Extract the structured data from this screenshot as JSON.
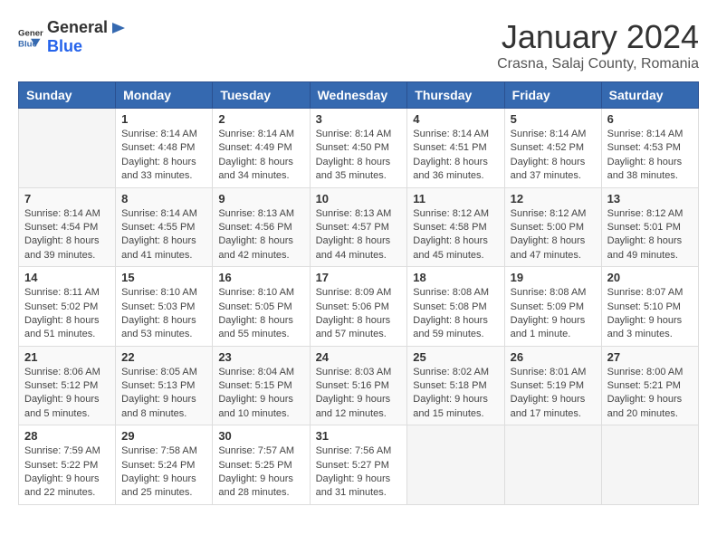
{
  "header": {
    "logo_general": "General",
    "logo_blue": "Blue",
    "title": "January 2024",
    "subtitle": "Crasna, Salaj County, Romania"
  },
  "days_of_week": [
    "Sunday",
    "Monday",
    "Tuesday",
    "Wednesday",
    "Thursday",
    "Friday",
    "Saturday"
  ],
  "weeks": [
    [
      {
        "day": "",
        "info": ""
      },
      {
        "day": "1",
        "info": "Sunrise: 8:14 AM\nSunset: 4:48 PM\nDaylight: 8 hours\nand 33 minutes."
      },
      {
        "day": "2",
        "info": "Sunrise: 8:14 AM\nSunset: 4:49 PM\nDaylight: 8 hours\nand 34 minutes."
      },
      {
        "day": "3",
        "info": "Sunrise: 8:14 AM\nSunset: 4:50 PM\nDaylight: 8 hours\nand 35 minutes."
      },
      {
        "day": "4",
        "info": "Sunrise: 8:14 AM\nSunset: 4:51 PM\nDaylight: 8 hours\nand 36 minutes."
      },
      {
        "day": "5",
        "info": "Sunrise: 8:14 AM\nSunset: 4:52 PM\nDaylight: 8 hours\nand 37 minutes."
      },
      {
        "day": "6",
        "info": "Sunrise: 8:14 AM\nSunset: 4:53 PM\nDaylight: 8 hours\nand 38 minutes."
      }
    ],
    [
      {
        "day": "7",
        "info": "Sunrise: 8:14 AM\nSunset: 4:54 PM\nDaylight: 8 hours\nand 39 minutes."
      },
      {
        "day": "8",
        "info": "Sunrise: 8:14 AM\nSunset: 4:55 PM\nDaylight: 8 hours\nand 41 minutes."
      },
      {
        "day": "9",
        "info": "Sunrise: 8:13 AM\nSunset: 4:56 PM\nDaylight: 8 hours\nand 42 minutes."
      },
      {
        "day": "10",
        "info": "Sunrise: 8:13 AM\nSunset: 4:57 PM\nDaylight: 8 hours\nand 44 minutes."
      },
      {
        "day": "11",
        "info": "Sunrise: 8:12 AM\nSunset: 4:58 PM\nDaylight: 8 hours\nand 45 minutes."
      },
      {
        "day": "12",
        "info": "Sunrise: 8:12 AM\nSunset: 5:00 PM\nDaylight: 8 hours\nand 47 minutes."
      },
      {
        "day": "13",
        "info": "Sunrise: 8:12 AM\nSunset: 5:01 PM\nDaylight: 8 hours\nand 49 minutes."
      }
    ],
    [
      {
        "day": "14",
        "info": "Sunrise: 8:11 AM\nSunset: 5:02 PM\nDaylight: 8 hours\nand 51 minutes."
      },
      {
        "day": "15",
        "info": "Sunrise: 8:10 AM\nSunset: 5:03 PM\nDaylight: 8 hours\nand 53 minutes."
      },
      {
        "day": "16",
        "info": "Sunrise: 8:10 AM\nSunset: 5:05 PM\nDaylight: 8 hours\nand 55 minutes."
      },
      {
        "day": "17",
        "info": "Sunrise: 8:09 AM\nSunset: 5:06 PM\nDaylight: 8 hours\nand 57 minutes."
      },
      {
        "day": "18",
        "info": "Sunrise: 8:08 AM\nSunset: 5:08 PM\nDaylight: 8 hours\nand 59 minutes."
      },
      {
        "day": "19",
        "info": "Sunrise: 8:08 AM\nSunset: 5:09 PM\nDaylight: 9 hours\nand 1 minute."
      },
      {
        "day": "20",
        "info": "Sunrise: 8:07 AM\nSunset: 5:10 PM\nDaylight: 9 hours\nand 3 minutes."
      }
    ],
    [
      {
        "day": "21",
        "info": "Sunrise: 8:06 AM\nSunset: 5:12 PM\nDaylight: 9 hours\nand 5 minutes."
      },
      {
        "day": "22",
        "info": "Sunrise: 8:05 AM\nSunset: 5:13 PM\nDaylight: 9 hours\nand 8 minutes."
      },
      {
        "day": "23",
        "info": "Sunrise: 8:04 AM\nSunset: 5:15 PM\nDaylight: 9 hours\nand 10 minutes."
      },
      {
        "day": "24",
        "info": "Sunrise: 8:03 AM\nSunset: 5:16 PM\nDaylight: 9 hours\nand 12 minutes."
      },
      {
        "day": "25",
        "info": "Sunrise: 8:02 AM\nSunset: 5:18 PM\nDaylight: 9 hours\nand 15 minutes."
      },
      {
        "day": "26",
        "info": "Sunrise: 8:01 AM\nSunset: 5:19 PM\nDaylight: 9 hours\nand 17 minutes."
      },
      {
        "day": "27",
        "info": "Sunrise: 8:00 AM\nSunset: 5:21 PM\nDaylight: 9 hours\nand 20 minutes."
      }
    ],
    [
      {
        "day": "28",
        "info": "Sunrise: 7:59 AM\nSunset: 5:22 PM\nDaylight: 9 hours\nand 22 minutes."
      },
      {
        "day": "29",
        "info": "Sunrise: 7:58 AM\nSunset: 5:24 PM\nDaylight: 9 hours\nand 25 minutes."
      },
      {
        "day": "30",
        "info": "Sunrise: 7:57 AM\nSunset: 5:25 PM\nDaylight: 9 hours\nand 28 minutes."
      },
      {
        "day": "31",
        "info": "Sunrise: 7:56 AM\nSunset: 5:27 PM\nDaylight: 9 hours\nand 31 minutes."
      },
      {
        "day": "",
        "info": ""
      },
      {
        "day": "",
        "info": ""
      },
      {
        "day": "",
        "info": ""
      }
    ]
  ]
}
